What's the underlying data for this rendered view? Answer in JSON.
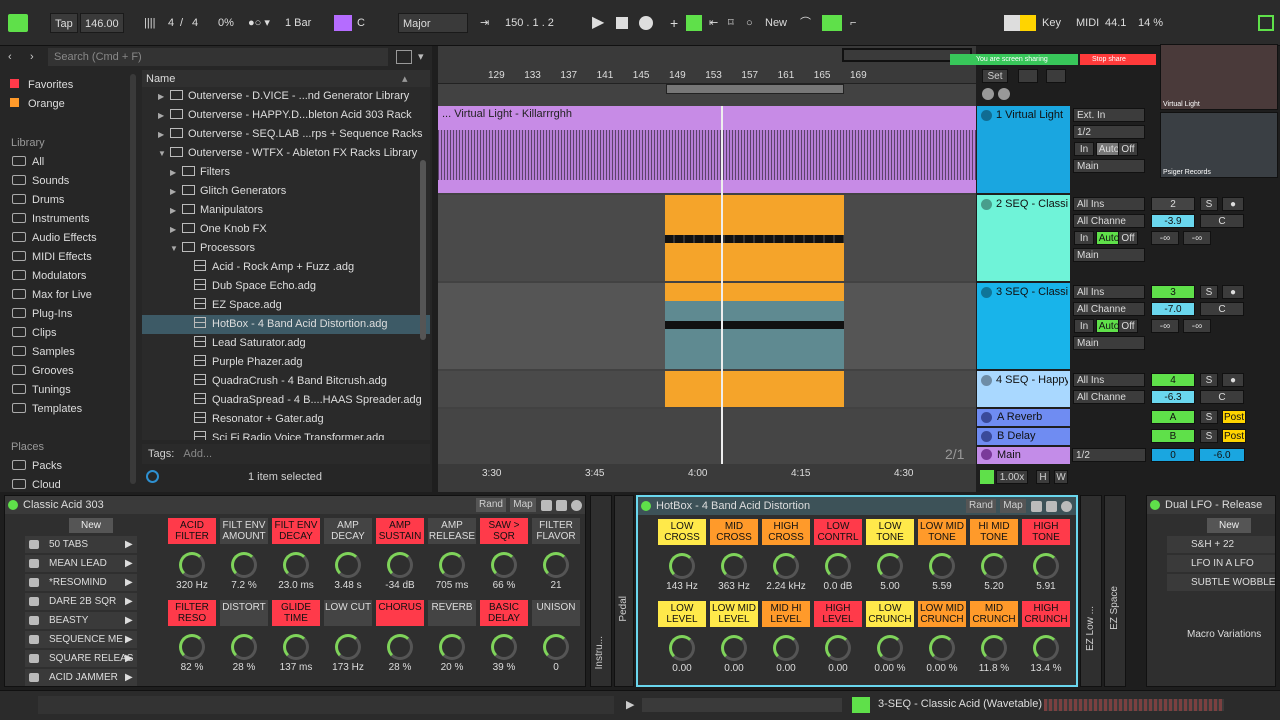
{
  "transport": {
    "tap": "Tap",
    "tempo": "146.00",
    "sig_num": "4",
    "sig_slash": "/",
    "sig_den": "4",
    "groove": "0%",
    "quantize": "1 Bar",
    "key": "C",
    "scale": "Major",
    "position": "150 .   1 .   2",
    "new_label": "New",
    "key_label": "Key",
    "midi_label": "MIDI",
    "sample_rate": "44.1",
    "cpu": "14 %"
  },
  "browser": {
    "search_placeholder": "Search (Cmd + F)",
    "name_header": "Name",
    "tags_label": "Tags:",
    "tags_add": "Add...",
    "status": "1 item selected",
    "collections": [
      {
        "label": "Favorites",
        "color": "#ff3a4a"
      },
      {
        "label": "Orange",
        "color": "#ff9a2a"
      }
    ],
    "library_label": "Library",
    "library": [
      "All",
      "Sounds",
      "Drums",
      "Instruments",
      "Audio Effects",
      "MIDI Effects",
      "Modulators",
      "Max for Live",
      "Plug-Ins",
      "Clips",
      "Samples",
      "Grooves",
      "Tunings",
      "Templates"
    ],
    "places_label": "Places",
    "places": [
      "Packs",
      "Cloud"
    ],
    "files": [
      {
        "label": "Outerverse - D.VICE - ...nd Generator Library",
        "kind": "folder",
        "indent": 0,
        "arrow": "▶"
      },
      {
        "label": "Outerverse - HAPPY.D...bleton Acid 303 Rack",
        "kind": "folder",
        "indent": 0,
        "arrow": "▶"
      },
      {
        "label": "Outerverse - SEQ.LAB ...rps + Sequence Racks",
        "kind": "folder",
        "indent": 0,
        "arrow": "▶"
      },
      {
        "label": "Outerverse - WTFX - Ableton FX Racks Library",
        "kind": "folder",
        "indent": 0,
        "arrow": "▼"
      },
      {
        "label": "Filters",
        "kind": "folder",
        "indent": 1,
        "arrow": "▶"
      },
      {
        "label": "Glitch Generators",
        "kind": "folder",
        "indent": 1,
        "arrow": "▶"
      },
      {
        "label": "Manipulators",
        "kind": "folder",
        "indent": 1,
        "arrow": "▶"
      },
      {
        "label": "One Knob FX",
        "kind": "folder",
        "indent": 1,
        "arrow": "▶"
      },
      {
        "label": "Processors",
        "kind": "folder",
        "indent": 1,
        "arrow": "▼"
      },
      {
        "label": "Acid - Rock Amp + Fuzz .adg",
        "kind": "adg",
        "indent": 2,
        "arrow": ""
      },
      {
        "label": "Dub Space Echo.adg",
        "kind": "adg",
        "indent": 2,
        "arrow": ""
      },
      {
        "label": "EZ Space.adg",
        "kind": "adg",
        "indent": 2,
        "arrow": ""
      },
      {
        "label": "HotBox - 4 Band Acid Distortion.adg",
        "kind": "adg",
        "indent": 2,
        "arrow": "",
        "selected": true
      },
      {
        "label": "Lead Saturator.adg",
        "kind": "adg",
        "indent": 2,
        "arrow": ""
      },
      {
        "label": "Purple Phazer.adg",
        "kind": "adg",
        "indent": 2,
        "arrow": ""
      },
      {
        "label": "QuadraCrush - 4 Band Bitcrush.adg",
        "kind": "adg",
        "indent": 2,
        "arrow": ""
      },
      {
        "label": "QuadraSpread - 4 B....HAAS Spreader.adg",
        "kind": "adg",
        "indent": 2,
        "arrow": ""
      },
      {
        "label": "Resonator + Gater.adg",
        "kind": "adg",
        "indent": 2,
        "arrow": ""
      },
      {
        "label": "Sci Fi Radio Voice Transformer.adg",
        "kind": "adg",
        "indent": 2,
        "arrow": ""
      }
    ]
  },
  "arrangement": {
    "bars": [
      "129",
      "133",
      "137",
      "141",
      "145",
      "149",
      "153",
      "157",
      "161",
      "165",
      "169"
    ],
    "times": [
      "3:30",
      "3:45",
      "4:00",
      "4:15",
      "4:30"
    ],
    "clip_title": "... Virtual Light - Killarrrghh",
    "set_label": "Set",
    "page": "2/1",
    "zoom": "1.00x",
    "h_label": "H",
    "w_label": "W"
  },
  "tracks": [
    {
      "name": "1 Virtual Light",
      "color": "#1aa6e0",
      "input": "Ext. In",
      "channel": "1/2",
      "monitor": [
        "In",
        "Auto",
        "Off"
      ],
      "out": "Main"
    },
    {
      "name": "2 SEQ - Classic",
      "color": "#6ff3d8",
      "input": "All Ins",
      "channel": "All Channe",
      "monitor": [
        "In",
        "Auto",
        "Off"
      ],
      "out": "Main",
      "num": "2",
      "vol": "-3.9",
      "pan": "C",
      "inf1": "-∞",
      "inf2": "-∞"
    },
    {
      "name": "3 SEQ - Classic",
      "color": "#18b4ea",
      "input": "All Ins",
      "channel": "All Channe",
      "monitor": [
        "In",
        "Auto",
        "Off"
      ],
      "out": "Main",
      "num": "3",
      "vol": "-7.0",
      "pan": "C",
      "inf1": "-∞",
      "inf2": "-∞"
    },
    {
      "name": "4 SEQ - Happy",
      "color": "#a9d8ff",
      "input": "All Ins",
      "channel": "All Channe",
      "num": "4",
      "vol": "-6.3",
      "pan": "C"
    }
  ],
  "returns": [
    {
      "name": "A Reverb",
      "letter": "A",
      "s": "S",
      "post": "Post"
    },
    {
      "name": "B Delay",
      "letter": "B",
      "s": "S",
      "post": "Post"
    }
  ],
  "master": {
    "name": "Main",
    "out": "1/2",
    "vol": "0",
    "db": "-6.0"
  },
  "device1": {
    "title": "Classic Acid 303",
    "rand": "Rand",
    "map": "Map",
    "new": "New",
    "variations": [
      "50 TABS",
      "MEAN LEAD",
      "*RESOMIND",
      "DARE 2B SQR",
      "BEASTY",
      "SEQUENCE ME",
      "SQUARE RELEAS",
      "ACID JAMMER"
    ],
    "macros": [
      {
        "label": "ACID FILTER",
        "value": "320 Hz",
        "color": "red"
      },
      {
        "label": "FILT ENV AMOUNT",
        "value": "7.2 %",
        "color": "dgr"
      },
      {
        "label": "FILT ENV DECAY",
        "value": "23.0 ms",
        "color": "red"
      },
      {
        "label": "AMP DECAY",
        "value": "3.48 s",
        "color": "dgr"
      },
      {
        "label": "AMP SUSTAIN",
        "value": "-34 dB",
        "color": "red"
      },
      {
        "label": "AMP RELEASE",
        "value": "705 ms",
        "color": "dgr"
      },
      {
        "label": "SAW > SQR",
        "value": "66 %",
        "color": "red"
      },
      {
        "label": "FILTER FLAVOR",
        "value": "21",
        "color": "dgr"
      },
      {
        "label": "FILTER RESO",
        "value": "82 %",
        "color": "red"
      },
      {
        "label": "DISTORT",
        "value": "28 %",
        "color": "dgr"
      },
      {
        "label": "GLIDE TIME",
        "value": "137 ms",
        "color": "red"
      },
      {
        "label": "LOW CUT",
        "value": "173 Hz",
        "color": "dgr"
      },
      {
        "label": "CHORUS",
        "value": "28 %",
        "color": "red"
      },
      {
        "label": "REVERB",
        "value": "20 %",
        "color": "dgr"
      },
      {
        "label": "BASIC DELAY",
        "value": "39 %",
        "color": "red"
      },
      {
        "label": "UNISON",
        "value": "0",
        "color": "dgr"
      }
    ]
  },
  "device_side": {
    "instru": "Instru...",
    "pedal": "Pedal"
  },
  "device2": {
    "title": "HotBox - 4 Band Acid Distortion",
    "rand": "Rand",
    "map": "Map",
    "macros": [
      {
        "label": "LOW CROSS",
        "value": "143 Hz",
        "color": "lyel"
      },
      {
        "label": "MID CROSS",
        "value": "363 Hz",
        "color": "org"
      },
      {
        "label": "HIGH CROSS",
        "value": "2.24 kHz",
        "color": "org"
      },
      {
        "label": "LOW CONTRL",
        "value": "0.0 dB",
        "color": "red"
      },
      {
        "label": "LOW TONE",
        "value": "5.00",
        "color": "lyel"
      },
      {
        "label": "LOW MID TONE",
        "value": "5.59",
        "color": "org"
      },
      {
        "label": "HI MID TONE",
        "value": "5.20",
        "color": "org"
      },
      {
        "label": "HIGH TONE",
        "value": "5.91",
        "color": "red"
      },
      {
        "label": "LOW LEVEL",
        "value": "0.00",
        "color": "lyel"
      },
      {
        "label": "LOW MID LEVEL",
        "value": "0.00",
        "color": "lyel"
      },
      {
        "label": "MID HI LEVEL",
        "value": "0.00",
        "color": "org"
      },
      {
        "label": "HIGH LEVEL",
        "value": "0.00",
        "color": "red"
      },
      {
        "label": "LOW CRUNCH",
        "value": "0.00 %",
        "color": "lyel"
      },
      {
        "label": "LOW MID CRUNCH",
        "value": "0.00 %",
        "color": "org"
      },
      {
        "label": "MID CRUNCH",
        "value": "11.8 %",
        "color": "org"
      },
      {
        "label": "HIGH CRUNCH",
        "value": "13.4 %",
        "color": "red"
      }
    ]
  },
  "device_side2": {
    "ezlow": "EZ Low ...",
    "ezspace": "EZ Space"
  },
  "device3": {
    "title": "Dual LFO - Release",
    "new": "New",
    "variations": [
      "S&H + 22",
      "LFO IN A LFO",
      "SUBTLE WOBBLE"
    ],
    "macro_variations": "Macro Variations"
  },
  "status": {
    "clip": "3-SEQ - Classic Acid (Wavetable)"
  },
  "webcams": [
    {
      "label": "Virtual Light"
    },
    {
      "label": "Psiger Records"
    }
  ],
  "screenshare": {
    "text": "You are screen sharing",
    "stop": "Stop share"
  }
}
